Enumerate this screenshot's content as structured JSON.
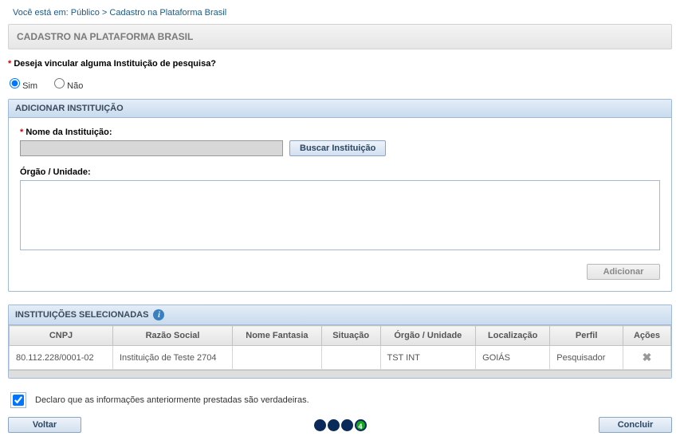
{
  "breadcrumb": {
    "prefix": "Você está em:",
    "path1": "Público",
    "sep": ">",
    "path2": "Cadastro na Plataforma Brasil"
  },
  "page_title": "CADASTRO NA PLATAFORMA BRASIL",
  "question": {
    "asterisk": "*",
    "text": " Deseja vincular alguma Instituição de pesquisa?"
  },
  "radios": {
    "yes": "Sim",
    "no": "Não"
  },
  "panel_add": {
    "title": "ADICIONAR INSTITUIÇÃO",
    "name_label_asterisk": "*",
    "name_label": " Nome da Instituição:",
    "search_btn": "Buscar Instituição",
    "org_label": "Órgão / Unidade:",
    "add_btn": "Adicionar"
  },
  "panel_sel": {
    "title": "INSTITUIÇÕES SELECIONADAS",
    "columns": {
      "cnpj": "CNPJ",
      "razao": "Razão Social",
      "fantasia": "Nome Fantasia",
      "situacao": "Situação",
      "orgao": "Órgão / Unidade",
      "local": "Localização",
      "perfil": "Perfil",
      "acoes": "Ações"
    },
    "rows": [
      {
        "cnpj": "80.112.228/0001-02",
        "razao": "Instituição de Teste 2704",
        "fantasia": "",
        "situacao": "",
        "orgao": "TST INT",
        "local": "GOIÁS",
        "perfil": "Pesquisador"
      }
    ]
  },
  "declaration": "Declaro que as informações anteriormente prestadas são verdadeiras.",
  "footer": {
    "back": "Voltar",
    "conclude": "Concluir",
    "step_active": "4"
  }
}
